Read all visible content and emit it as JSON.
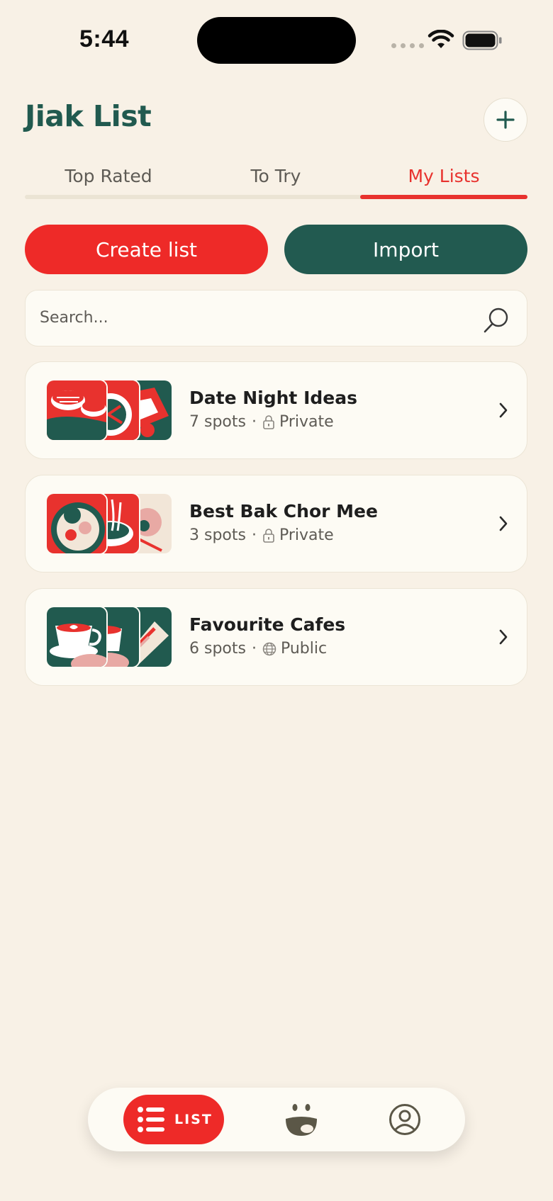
{
  "status_bar": {
    "time": "5:44"
  },
  "header": {
    "title": "Jiak List",
    "add_icon": "plus-icon"
  },
  "tabs": [
    {
      "label": "Top Rated",
      "active": false
    },
    {
      "label": "To Try",
      "active": false
    },
    {
      "label": "My Lists",
      "active": true
    }
  ],
  "actions": {
    "create_label": "Create list",
    "import_label": "Import"
  },
  "search": {
    "placeholder": "Search...",
    "value": "",
    "icon": "search-icon"
  },
  "lists": [
    {
      "title": "Date Night Ideas",
      "spots": "7 spots",
      "visibility": "Private",
      "visibility_icon": "lock-icon"
    },
    {
      "title": "Best Bak Chor Mee",
      "spots": "3 spots",
      "visibility": "Private",
      "visibility_icon": "lock-icon"
    },
    {
      "title": "Favourite Cafes",
      "spots": "6 spots",
      "visibility": "Public",
      "visibility_icon": "globe-icon"
    }
  ],
  "bottom_nav": {
    "list_label": "LIST"
  },
  "colors": {
    "brand_green": "#215a4f",
    "accent_red": "#ee2a28",
    "background": "#f8f1e6"
  }
}
